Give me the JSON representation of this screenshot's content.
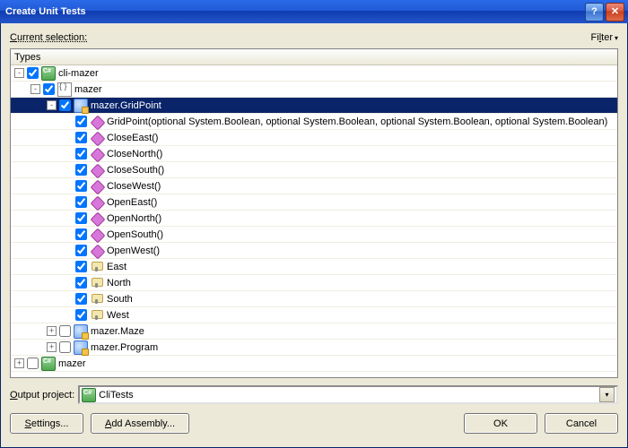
{
  "title": "Create Unit Tests",
  "current_selection_label": "Current selection:",
  "filter_label": "Filter",
  "types_header": "Types",
  "output_label": "Output project:",
  "output_project": "CliTests",
  "buttons": {
    "settings": "Settings...",
    "add_assembly": "Add Assembly...",
    "ok": "OK",
    "cancel": "Cancel"
  },
  "tree": [
    {
      "indent": 0,
      "exp": "-",
      "checked": true,
      "icon": "csproj",
      "label": "cli-mazer",
      "sel": false,
      "interact": true
    },
    {
      "indent": 1,
      "exp": "-",
      "checked": true,
      "icon": "ns",
      "label": "mazer",
      "sel": false,
      "interact": true
    },
    {
      "indent": 2,
      "exp": "-",
      "checked": true,
      "icon": "class",
      "label": "mazer.GridPoint",
      "sel": true,
      "interact": true
    },
    {
      "indent": 3,
      "exp": "",
      "checked": true,
      "icon": "method",
      "label": "GridPoint(optional System.Boolean, optional System.Boolean, optional System.Boolean, optional System.Boolean)",
      "sel": false,
      "interact": true
    },
    {
      "indent": 3,
      "exp": "",
      "checked": true,
      "icon": "method",
      "label": "CloseEast()",
      "sel": false,
      "interact": true
    },
    {
      "indent": 3,
      "exp": "",
      "checked": true,
      "icon": "method",
      "label": "CloseNorth()",
      "sel": false,
      "interact": true
    },
    {
      "indent": 3,
      "exp": "",
      "checked": true,
      "icon": "method",
      "label": "CloseSouth()",
      "sel": false,
      "interact": true
    },
    {
      "indent": 3,
      "exp": "",
      "checked": true,
      "icon": "method",
      "label": "CloseWest()",
      "sel": false,
      "interact": true
    },
    {
      "indent": 3,
      "exp": "",
      "checked": true,
      "icon": "method",
      "label": "OpenEast()",
      "sel": false,
      "interact": true
    },
    {
      "indent": 3,
      "exp": "",
      "checked": true,
      "icon": "method",
      "label": "OpenNorth()",
      "sel": false,
      "interact": true
    },
    {
      "indent": 3,
      "exp": "",
      "checked": true,
      "icon": "method",
      "label": "OpenSouth()",
      "sel": false,
      "interact": true
    },
    {
      "indent": 3,
      "exp": "",
      "checked": true,
      "icon": "method",
      "label": "OpenWest()",
      "sel": false,
      "interact": true
    },
    {
      "indent": 3,
      "exp": "",
      "checked": true,
      "icon": "prop",
      "label": "East",
      "sel": false,
      "interact": true
    },
    {
      "indent": 3,
      "exp": "",
      "checked": true,
      "icon": "prop",
      "label": "North",
      "sel": false,
      "interact": true
    },
    {
      "indent": 3,
      "exp": "",
      "checked": true,
      "icon": "prop",
      "label": "South",
      "sel": false,
      "interact": true
    },
    {
      "indent": 3,
      "exp": "",
      "checked": true,
      "icon": "prop",
      "label": "West",
      "sel": false,
      "interact": true
    },
    {
      "indent": 2,
      "exp": "+",
      "checked": false,
      "icon": "class",
      "label": "mazer.Maze",
      "sel": false,
      "interact": true
    },
    {
      "indent": 2,
      "exp": "+",
      "checked": false,
      "icon": "class",
      "label": "mazer.Program",
      "sel": false,
      "interact": true
    },
    {
      "indent": 0,
      "exp": "+",
      "checked": false,
      "icon": "csproj",
      "label": "mazer",
      "sel": false,
      "interact": true
    }
  ]
}
